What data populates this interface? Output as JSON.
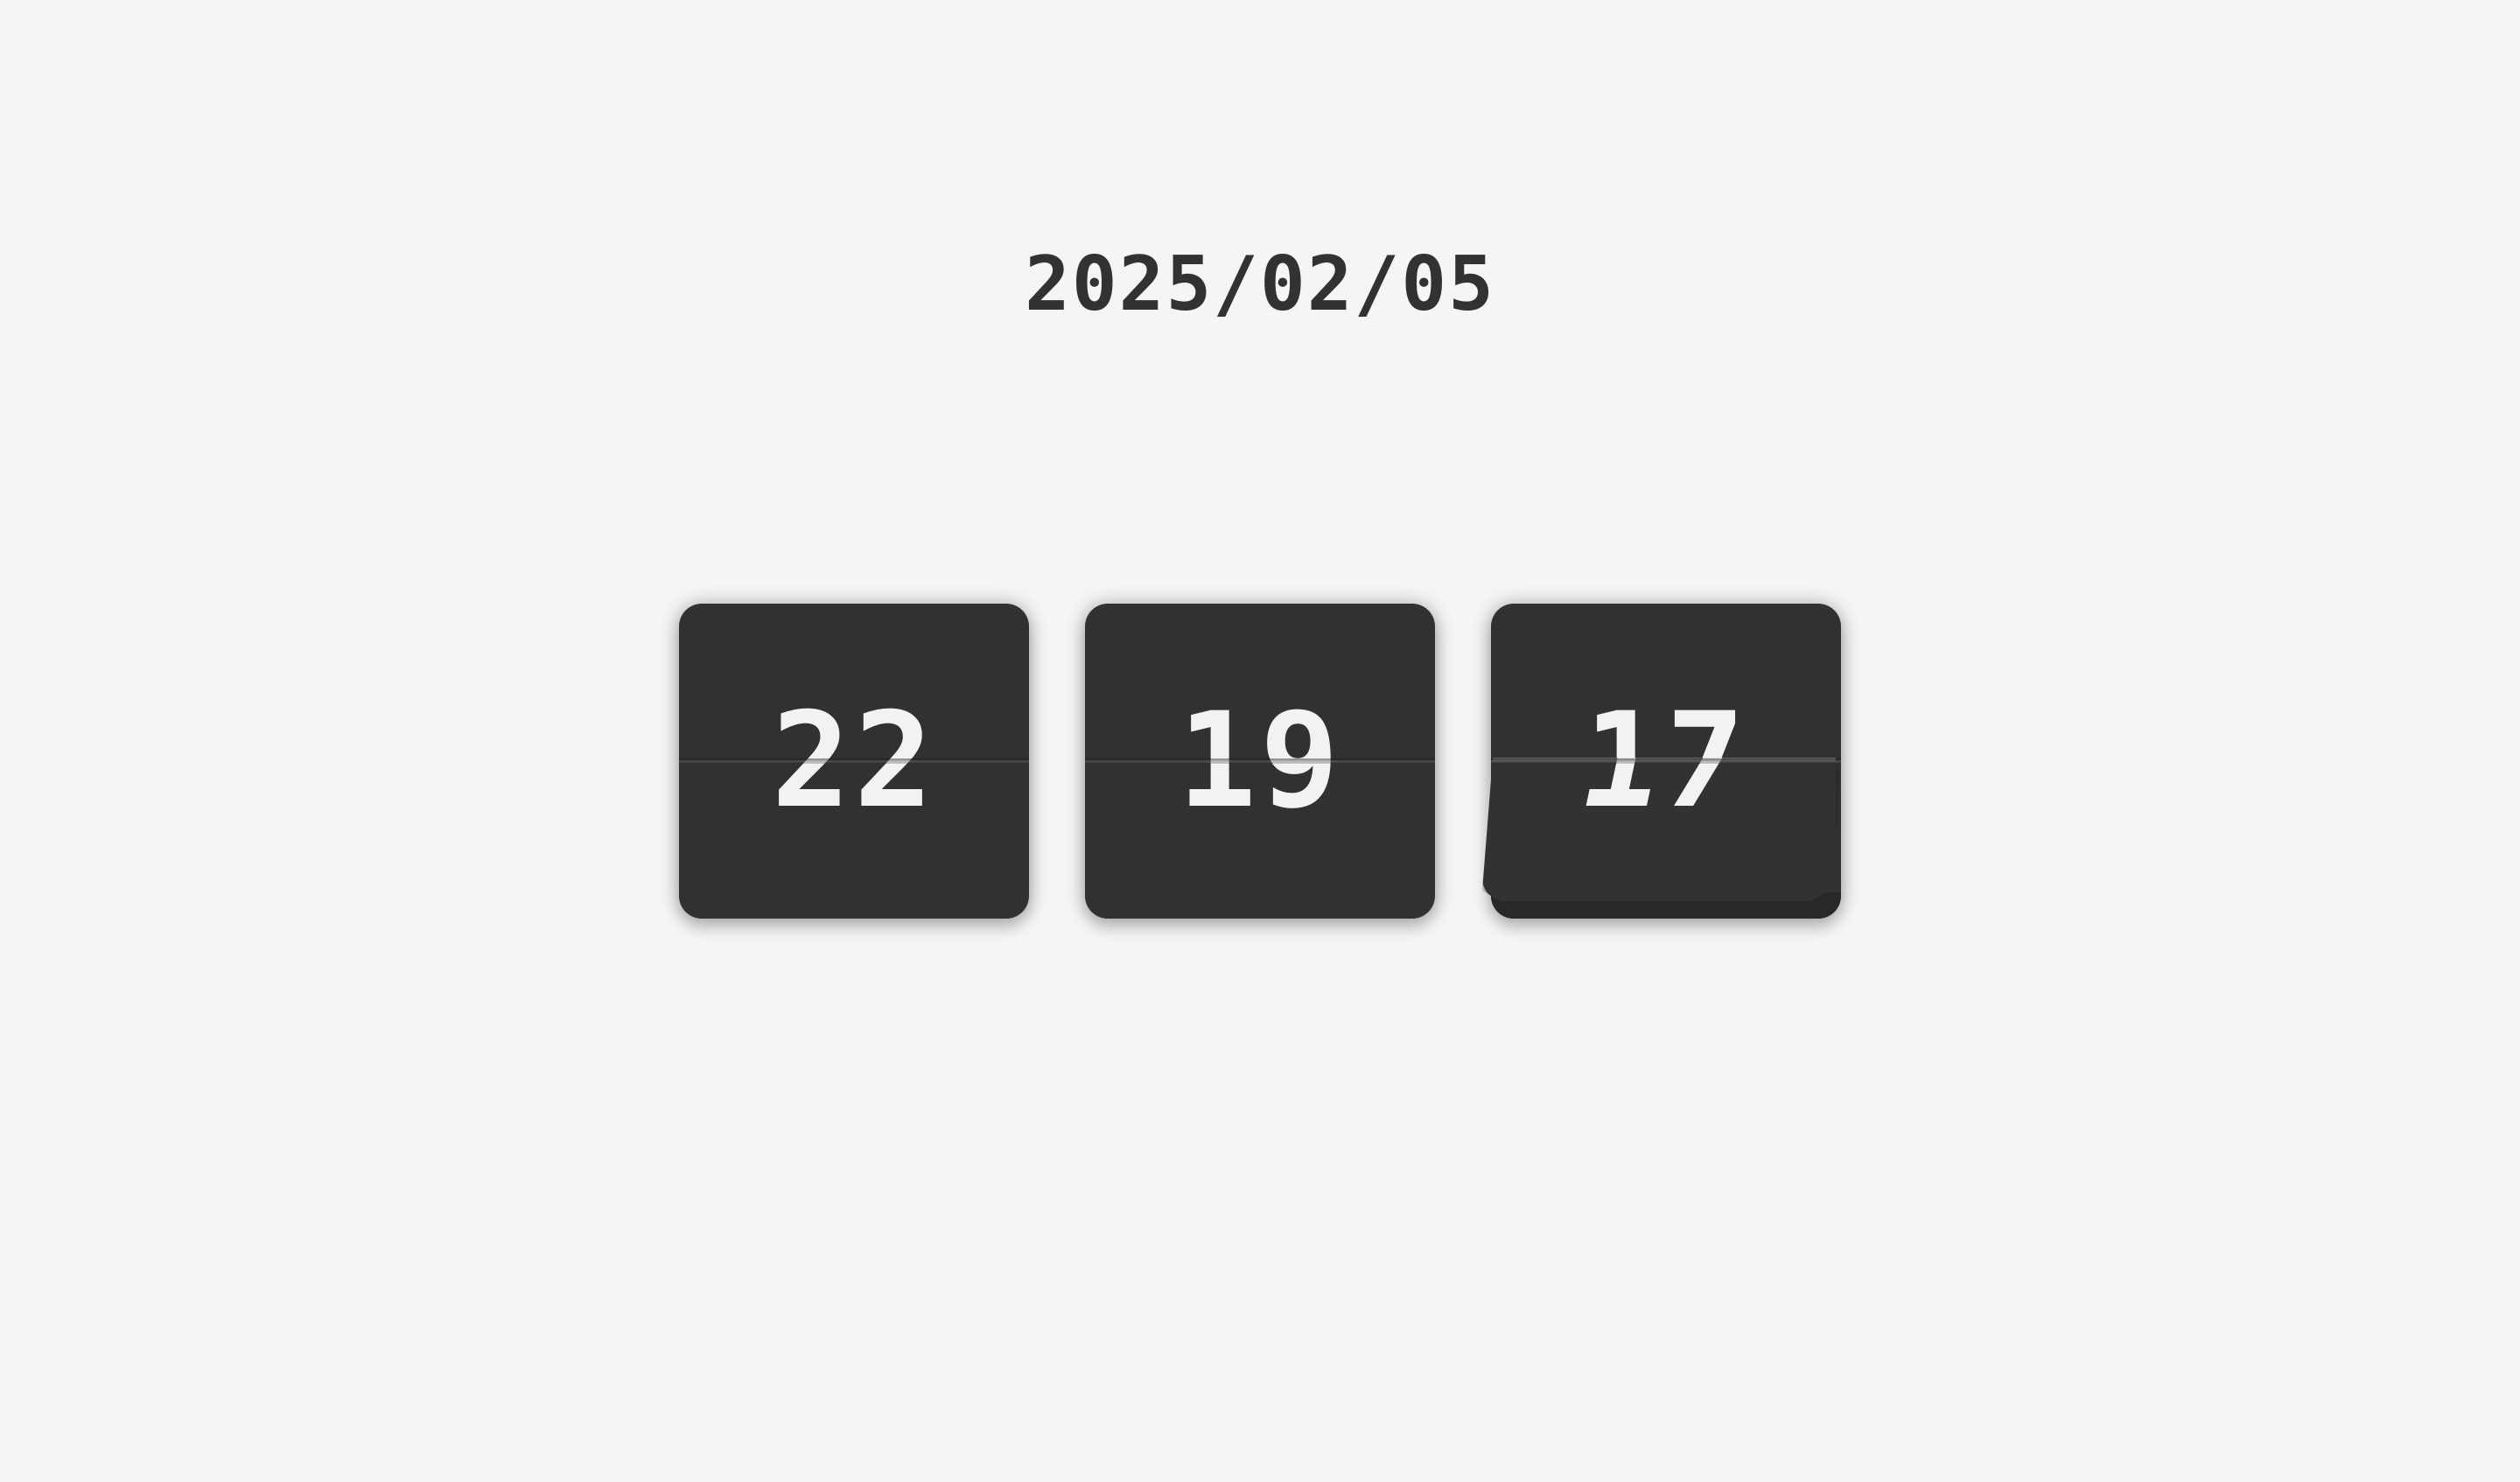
{
  "date": "2025/02/05",
  "clock": {
    "hours": "22",
    "minutes": "19",
    "seconds": "17"
  },
  "colors": {
    "background": "#f5f5f5",
    "card": "#333031",
    "digit": "#f2f2f2",
    "date_text": "#343132"
  }
}
